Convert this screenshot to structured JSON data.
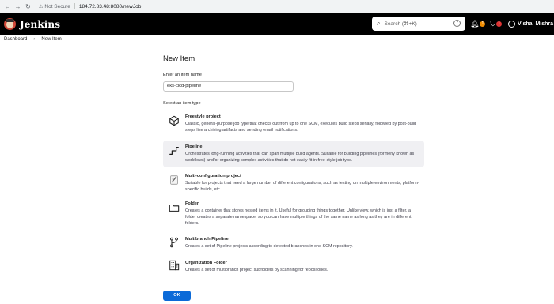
{
  "browser": {
    "security_label": "Not Secure",
    "url": "184.72.83.48:8080/newJob"
  },
  "header": {
    "app_title": "Jenkins",
    "search_placeholder": "Search (⌘+K)",
    "notification_count": "1",
    "security_count": "1",
    "user_name": "Vishal Mishra"
  },
  "breadcrumb": {
    "items": [
      "Dashboard",
      "New Item"
    ]
  },
  "main": {
    "title": "New Item",
    "name_label": "Enter an item name",
    "name_value": "eks-cicd-pipeline",
    "type_label": "Select an item type",
    "item_types": [
      {
        "title": "Freestyle project",
        "description": "Classic, general-purpose job type that checks out from up to one SCM, executes build steps serially, followed by post-build steps like archiving artifacts and sending email notifications.",
        "icon": "freestyle-cube-icon",
        "selected": false
      },
      {
        "title": "Pipeline",
        "description": "Orchestrates long-running activities that can span multiple build agents. Suitable for building pipelines (formerly known as workflows) and/or organizing complex activities that do not easily fit in free-style job type.",
        "icon": "pipeline-icon",
        "selected": true
      },
      {
        "title": "Multi-configuration project",
        "description": "Suitable for projects that need a large number of different configurations, such as testing on multiple environments, platform-specific builds, etc.",
        "icon": "multi-configuration-icon",
        "selected": false
      },
      {
        "title": "Folder",
        "description": "Creates a container that stores nested items in it. Useful for grouping things together. Unlike view, which is just a filter, a folder creates a separate namespace, so you can have multiple things of the same name as long as they are in different folders.",
        "icon": "folder-icon",
        "selected": false
      },
      {
        "title": "Multibranch Pipeline",
        "description": "Creates a set of Pipeline projects according to detected branches in one SCM repository.",
        "icon": "multibranch-icon",
        "selected": false
      },
      {
        "title": "Organization Folder",
        "description": "Creates a set of multibranch project subfolders by scanning for repositories.",
        "icon": "organization-folder-icon",
        "selected": false
      }
    ],
    "ok_label": "OK"
  },
  "colors": {
    "header_bg": "#000000",
    "accent": "#0b6ad8",
    "selected_bg": "#f0f0f3",
    "badge_orange": "#f08c00",
    "badge_red": "#dd3333",
    "logo_red": "#d24939"
  }
}
